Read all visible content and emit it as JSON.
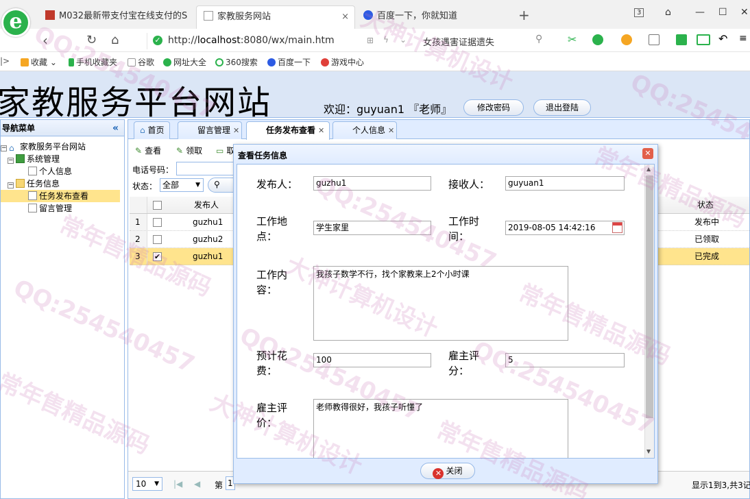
{
  "browser": {
    "tabs": [
      {
        "title": "M032最新带支付宝在线支付的S",
        "close": "×"
      },
      {
        "title": "家教服务网站",
        "close": "×"
      },
      {
        "title": "百度一下，你就知道",
        "close": "×"
      }
    ],
    "new_tab": "+",
    "tab_count": "3",
    "url_prefix": "http://",
    "url_host": "localhost",
    "url_path": ":8080/wx/main.htm",
    "search_suggestion": "女孩遇害证据遗失"
  },
  "bookmarks": [
    {
      "label": "收藏",
      "color": "#f5a623"
    },
    {
      "label": "手机收藏夹",
      "color": "#2bb24c"
    },
    {
      "label": "谷歌",
      "color": "#9e9e9e"
    },
    {
      "label": "网址大全",
      "color": "#2bb24c"
    },
    {
      "label": "360搜索",
      "color": "#2bb24c"
    },
    {
      "label": "百度一下",
      "color": "#2d5be3"
    },
    {
      "label": "游戏中心",
      "color": "#e0403a"
    }
  ],
  "header": {
    "site_title": "家教服务平台网站",
    "welcome": "欢迎：guyuan1 『老师』",
    "change_password": "修改密码",
    "logout": "退出登陆"
  },
  "nav": {
    "title": "导航菜单",
    "collapse": "«",
    "root": "家教服务平台网站",
    "groups": [
      {
        "label": "系统管理",
        "items": [
          "个人信息"
        ]
      },
      {
        "label": "任务信息",
        "items": [
          "任务发布查看",
          "留言管理"
        ]
      }
    ]
  },
  "tabs": [
    {
      "label": "首页"
    },
    {
      "label": "留言管理"
    },
    {
      "label": "任务发布查看"
    },
    {
      "label": "个人信息"
    }
  ],
  "toolbar": {
    "view": "查看",
    "claim": "领取",
    "third": "取"
  },
  "filters": {
    "phone_label": "电话号码：",
    "status_label": "状态：",
    "status_value": "全部"
  },
  "grid": {
    "col_publisher": "发布人",
    "col_status": "状态",
    "rows": [
      {
        "num": "1",
        "publisher": "guzhu1",
        "status": "发布中",
        "checked": false
      },
      {
        "num": "2",
        "publisher": "guzhu2",
        "status": "已领取",
        "checked": false
      },
      {
        "num": "3",
        "publisher": "guzhu1",
        "status": "已完成",
        "checked": true
      }
    ]
  },
  "pager": {
    "page_size": "10",
    "page_label": "第",
    "page_num": "1",
    "summary": "显示1到3,共3记"
  },
  "dialog": {
    "title": "查看任务信息",
    "publisher_label": "发布人：",
    "publisher_value": "guzhu1",
    "receiver_label": "接收人：",
    "receiver_value": "guyuan1",
    "location_label_1": "工作地",
    "location_label_2": "点：",
    "location_value": "学生家里",
    "time_label_1": "工作时",
    "time_label_2": "间：",
    "time_value": "2019-08-05 14:42:16",
    "content_label_1": "工作内",
    "content_label_2": "容：",
    "content_value": "我孩子数学不行，找个家教来上2个小时课",
    "cost_label_1": "预计花",
    "cost_label_2": "费：",
    "cost_value": "100",
    "score_label_1": "雇主评",
    "score_label_2": "分：",
    "score_value": "5",
    "comment_label_1": "雇主评",
    "comment_label_2": "价：",
    "comment_value": "老师教得很好，我孩子听懂了",
    "close_button": "关闭"
  },
  "watermarks": [
    "QQ:254540457",
    "大神计算机设计",
    "常年售精品源码"
  ]
}
